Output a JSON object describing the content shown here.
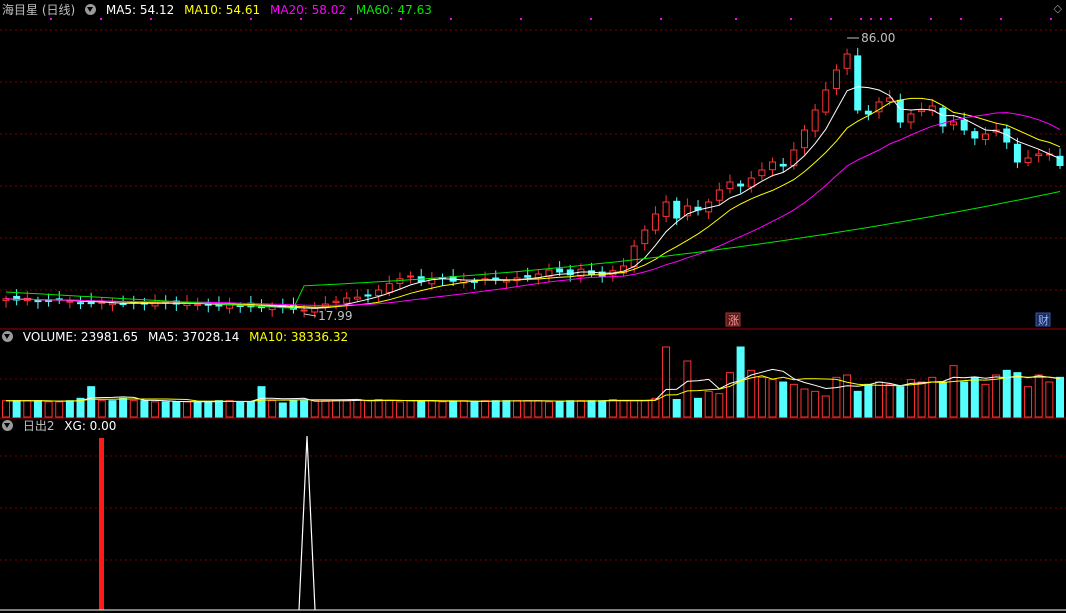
{
  "price_panel": {
    "title": "海目星 (日线)",
    "ma5": "MA5: 54.12",
    "ma10": "MA10: 54.61",
    "ma20": "MA20: 58.02",
    "ma60": "MA60: 47.63",
    "high_label": "86.00",
    "low_label": "17.99",
    "marker_zhang": "涨",
    "marker_cai": "财"
  },
  "volume_panel": {
    "label": "VOLUME: 23981.65",
    "ma5": "MA5: 37028.14",
    "ma10": "MA10: 38336.32"
  },
  "signal_panel": {
    "label": "日出2",
    "xg": "XG: 0.00"
  },
  "colors": {
    "up": "#ff3232",
    "down": "#54ffff",
    "ma5": "#ffffff",
    "ma10": "#ffff00",
    "ma20": "#ff00ff",
    "ma60": "#00e600",
    "grid": "#7a0000"
  },
  "chart_data": [
    {
      "type": "candlestick",
      "title": "海目星 (日线)",
      "ylim": [
        15,
        90
      ],
      "annotations": [
        "86.00",
        "17.99"
      ],
      "closes": [
        20.8,
        20.5,
        20.9,
        20.1,
        20.3,
        20.6,
        20.2,
        19.8,
        19.6,
        19.9,
        19.7,
        19.5,
        19.8,
        19.6,
        19.9,
        19.7,
        19.5,
        19.8,
        19.4,
        19.2,
        19.0,
        19.3,
        19.1,
        18.8,
        18.7,
        19.0,
        18.6,
        18.2,
        17.99,
        18.4,
        19.5,
        20.2,
        21.0,
        21.2,
        21.5,
        23.0,
        24.6,
        25.8,
        26.5,
        25.1,
        25.8,
        25.9,
        25.2,
        25.5,
        25.0,
        25.8,
        25.6,
        25.4,
        26.0,
        26.2,
        27.0,
        28.0,
        27.5,
        26.8,
        28.2,
        27.0,
        26.5,
        27.8,
        29.0,
        34.0,
        38.0,
        42.0,
        45.0,
        41.0,
        44.0,
        43.0,
        45.0,
        48.0,
        50.0,
        49.0,
        51.0,
        53.0,
        55.0,
        54.0,
        58.0,
        63.0,
        68.0,
        73.0,
        78.0,
        82.0,
        68.0,
        67.0,
        70.0,
        71.0,
        65.0,
        67.0,
        68.0,
        69.0,
        64.0,
        65.0,
        63.0,
        61.0,
        62.0,
        63.0,
        60.0,
        55.0,
        56.0,
        57.0,
        57.0,
        54.12
      ],
      "ma60_start": 22.5,
      "ma60_end": 47.63
    },
    {
      "type": "bar",
      "title": "VOLUME",
      "values": [
        14,
        14,
        14,
        14,
        13,
        13,
        14,
        16,
        26,
        14,
        14,
        16,
        14,
        14,
        13,
        13,
        13,
        13,
        13,
        13,
        14,
        14,
        13,
        13,
        26,
        14,
        12,
        14,
        14,
        14,
        14,
        14,
        14,
        15,
        14,
        15,
        14,
        13,
        14,
        14,
        14,
        13,
        13,
        14,
        13,
        14,
        14,
        14,
        14,
        14,
        14,
        13,
        13,
        14,
        14,
        14,
        14,
        15,
        14,
        14,
        14,
        16,
        60,
        15,
        48,
        16,
        22,
        20,
        38,
        60,
        40,
        34,
        32,
        30,
        28,
        24,
        22,
        18,
        34,
        36,
        22,
        28,
        30,
        28,
        26,
        32,
        30,
        34,
        30,
        44,
        30,
        34,
        28,
        36,
        40,
        38,
        26,
        36,
        30,
        34
      ],
      "ylim": [
        0,
        70000
      ]
    },
    {
      "type": "line",
      "title": "日出2 XG",
      "series": [
        {
          "name": "XG",
          "values": [
            0,
            1,
            0
          ]
        }
      ],
      "signal_positions": [
        101,
        307
      ]
    }
  ]
}
